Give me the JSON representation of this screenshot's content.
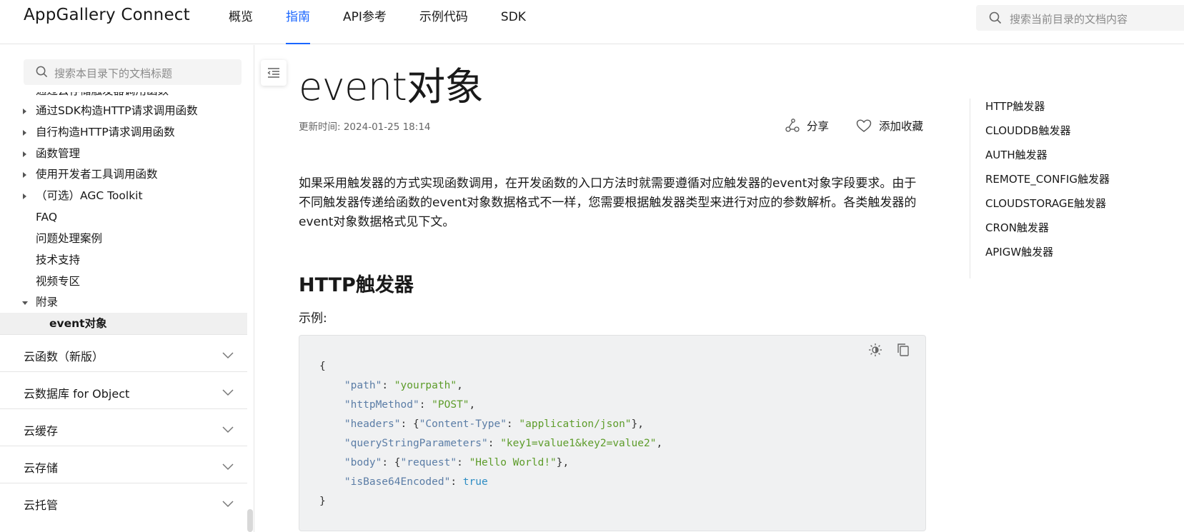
{
  "header": {
    "logo": "AppGallery Connect",
    "nav": [
      "概览",
      "指南",
      "API参考",
      "示例代码",
      "SDK"
    ],
    "active_nav": "指南",
    "search_placeholder": "搜索当前目录的文档内容"
  },
  "sidebar": {
    "search_placeholder": "搜索本目录下的文档标题",
    "cut_item": "通过云存储触发器调用函数",
    "items": [
      {
        "label": "通过SDK构造HTTP请求调用函数",
        "arrow": "right"
      },
      {
        "label": "自行构造HTTP请求调用函数",
        "arrow": "right"
      },
      {
        "label": "函数管理",
        "arrow": "right"
      },
      {
        "label": "使用开发者工具调用函数",
        "arrow": "right"
      },
      {
        "label": "（可选）AGC Toolkit",
        "arrow": "right"
      },
      {
        "label": "FAQ",
        "arrow": "none"
      },
      {
        "label": "问题处理案例",
        "arrow": "none"
      },
      {
        "label": "技术支持",
        "arrow": "none"
      },
      {
        "label": "视频专区",
        "arrow": "none"
      },
      {
        "label": "附录",
        "arrow": "down"
      },
      {
        "label": "event对象",
        "arrow": "none",
        "selected": true
      }
    ],
    "sections": [
      "云函数（新版）",
      "云数据库 for Object",
      "云缓存",
      "云存储",
      "云托管"
    ]
  },
  "article": {
    "title": "event对象",
    "updated": "更新时间: 2024-01-25 18:14",
    "share": "分享",
    "favorite": "添加收藏",
    "intro": "如果采用触发器的方式实现函数调用，在开发函数的入口方法时就需要遵循对应触发器的event对象字段要求。由于不同触发器传递给函数的event对象数据格式不一样，您需要根据触发器类型来进行对应的参数解析。各类触发器的event对象数据格式见下文。",
    "h2": "HTTP触发器",
    "example_label": "示例:",
    "code": {
      "open": "{",
      "lines": [
        {
          "key": "\"path\"",
          "sep": ": ",
          "val": "\"yourpath\"",
          "tail": ","
        },
        {
          "key": "\"httpMethod\"",
          "sep": ": ",
          "val": "\"POST\"",
          "tail": ","
        },
        {
          "key": "\"headers\"",
          "sep": ": {",
          "val": "\"Content-Type\"",
          "sep2": ": ",
          "val2": "\"application/json\"",
          "tail": "},"
        },
        {
          "key": "\"queryStringParameters\"",
          "sep": ": ",
          "val": "\"key1=value1&key2=value2\"",
          "tail": ","
        },
        {
          "key": "\"body\"",
          "sep": ": {",
          "val": "\"request\"",
          "sep2": ": ",
          "val2": "\"Hello World!\"",
          "tail": "},"
        },
        {
          "key": "\"isBase64Encoded\"",
          "sep": ": ",
          "bool": "true",
          "tail": ""
        }
      ],
      "close": "}"
    }
  },
  "toc": [
    "HTTP触发器",
    "CLOUDDB触发器",
    "AUTH触发器",
    "REMOTE_CONFIG触发器",
    "CLOUDSTORAGE触发器",
    "CRON触发器",
    "APIGW触发器"
  ],
  "colors": {
    "accent": "#1a66ff",
    "code_key": "#5b7da6",
    "code_string": "#5d9c2a",
    "code_bool": "#2e8dc4"
  }
}
